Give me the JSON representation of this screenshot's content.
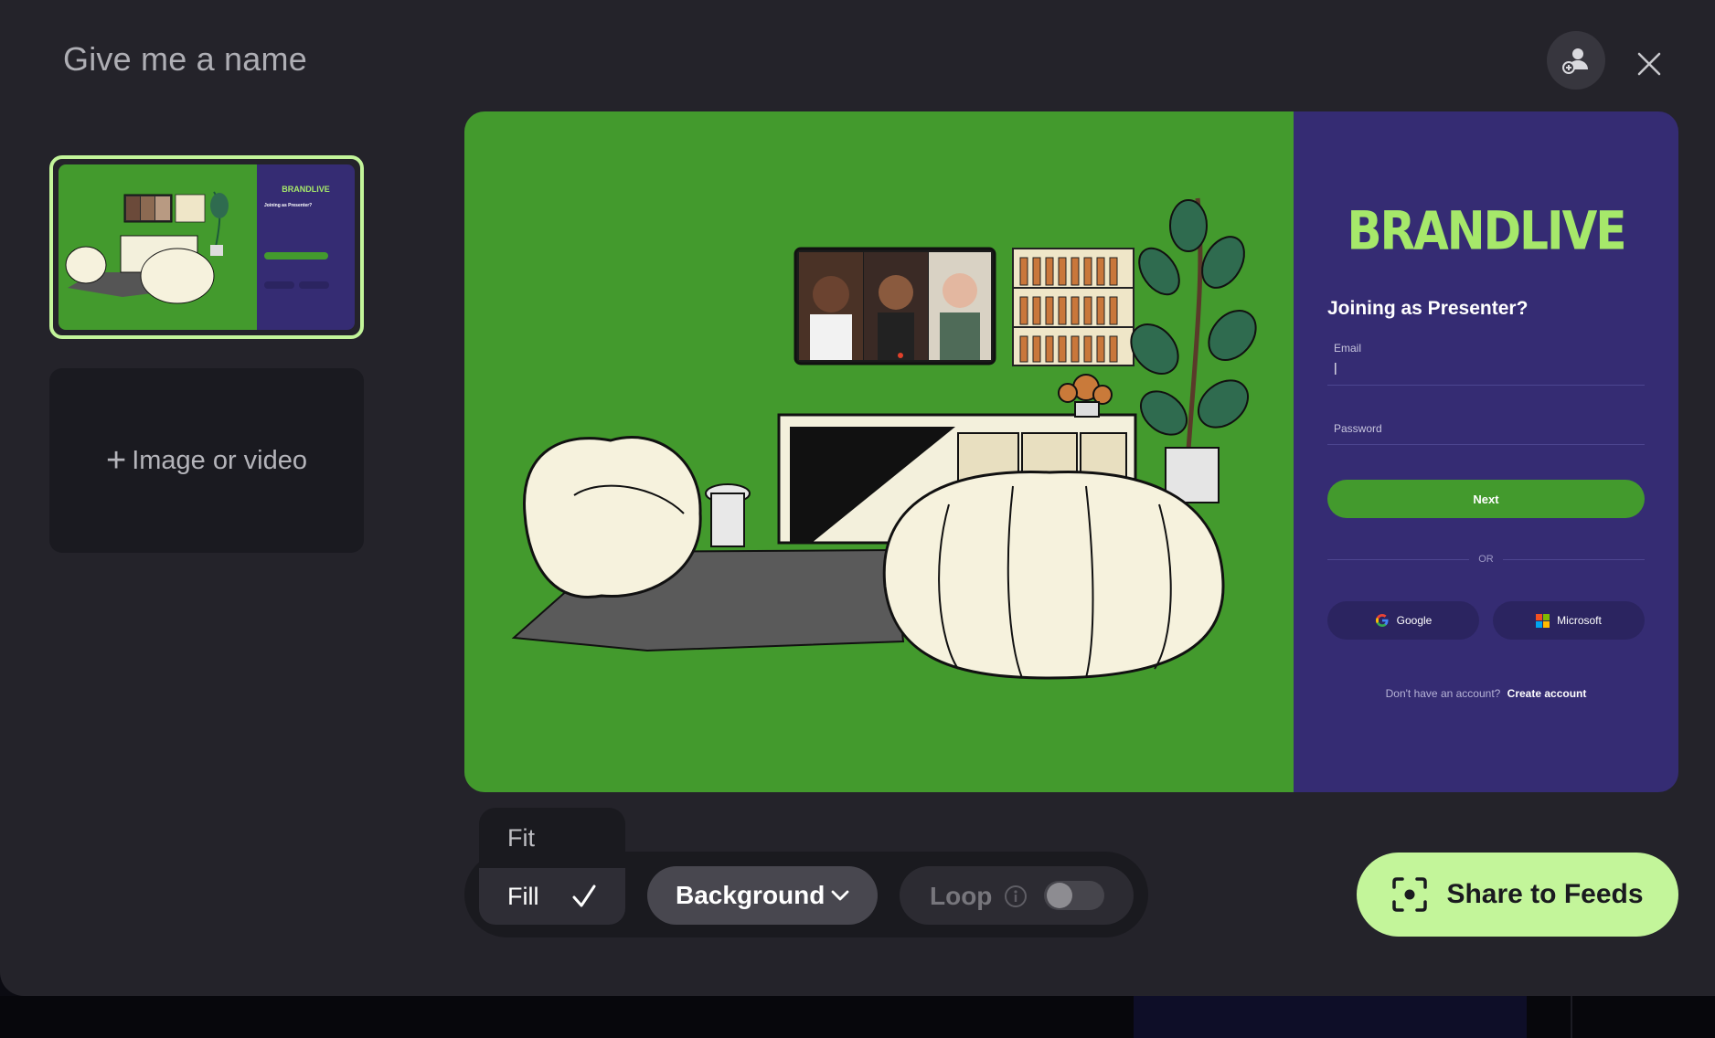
{
  "dialog": {
    "title": "Give me a name"
  },
  "header": {
    "invite_icon": "person-add-icon",
    "close_icon": "close-icon"
  },
  "sidebar": {
    "add_media_label": "Image or video",
    "thumbnail": {
      "brand": "BRANDLIVE",
      "heading": "Joining as Presenter?"
    }
  },
  "preview": {
    "brand": "BRANDLIVE",
    "login": {
      "heading": "Joining as Presenter?",
      "email_label": "Email",
      "email_value": "|",
      "password_label": "Password",
      "next_label": "Next",
      "or_label": "OR",
      "google_label": "Google",
      "microsoft_label": "Microsoft",
      "no_account_text": "Don't have an account?",
      "create_account_label": "Create account"
    }
  },
  "toolbar": {
    "fit_label": "Fit",
    "fill_label": "Fill",
    "background_label": "Background",
    "loop_label": "Loop",
    "loop_enabled": false,
    "selected_scale": "Fill"
  },
  "share": {
    "label": "Share to Feeds",
    "icon": "focus-capture-icon"
  },
  "colors": {
    "accent": "#c3f59a",
    "scene_green": "#439a2d",
    "panel_purple": "#352c73",
    "modal_bg": "#24232a"
  }
}
